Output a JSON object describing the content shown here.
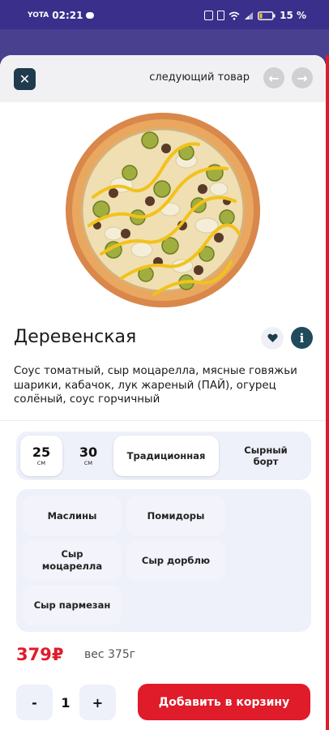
{
  "status_bar": {
    "carrier": "YOTA",
    "time": "02:21",
    "battery": "15 %"
  },
  "header": {
    "close_icon": "close-icon",
    "next_label": "следующий товар",
    "prev_icon": "arrow-left-icon",
    "next_icon": "arrow-right-icon"
  },
  "product": {
    "name": "Деревенская",
    "description": "Соус томатный, сыр моцарелла, мясные говяжьи шарики, кабачок, лук жареный (ПАЙ), огурец солёный, соус горчичный",
    "price": "379₽",
    "weight": "вес 375г"
  },
  "options": {
    "sizes": [
      {
        "value": "25",
        "unit": "см"
      },
      {
        "value": "30",
        "unit": "см"
      }
    ],
    "selected_size": "25",
    "crusts": [
      "Традиционная",
      "Сырный борт"
    ],
    "selected_crust": "Традиционная"
  },
  "ingredients": [
    "Маслины",
    "Помидоры",
    "Сыр моцарелла",
    "Сыр дорблю",
    "Сыр пармезан"
  ],
  "cart": {
    "minus": "-",
    "quantity": "1",
    "plus": "+",
    "add_label": "Добавить в корзину"
  },
  "colors": {
    "accent": "#e01b2a",
    "dark": "#1f3b4d",
    "panel": "#eef0fa"
  }
}
